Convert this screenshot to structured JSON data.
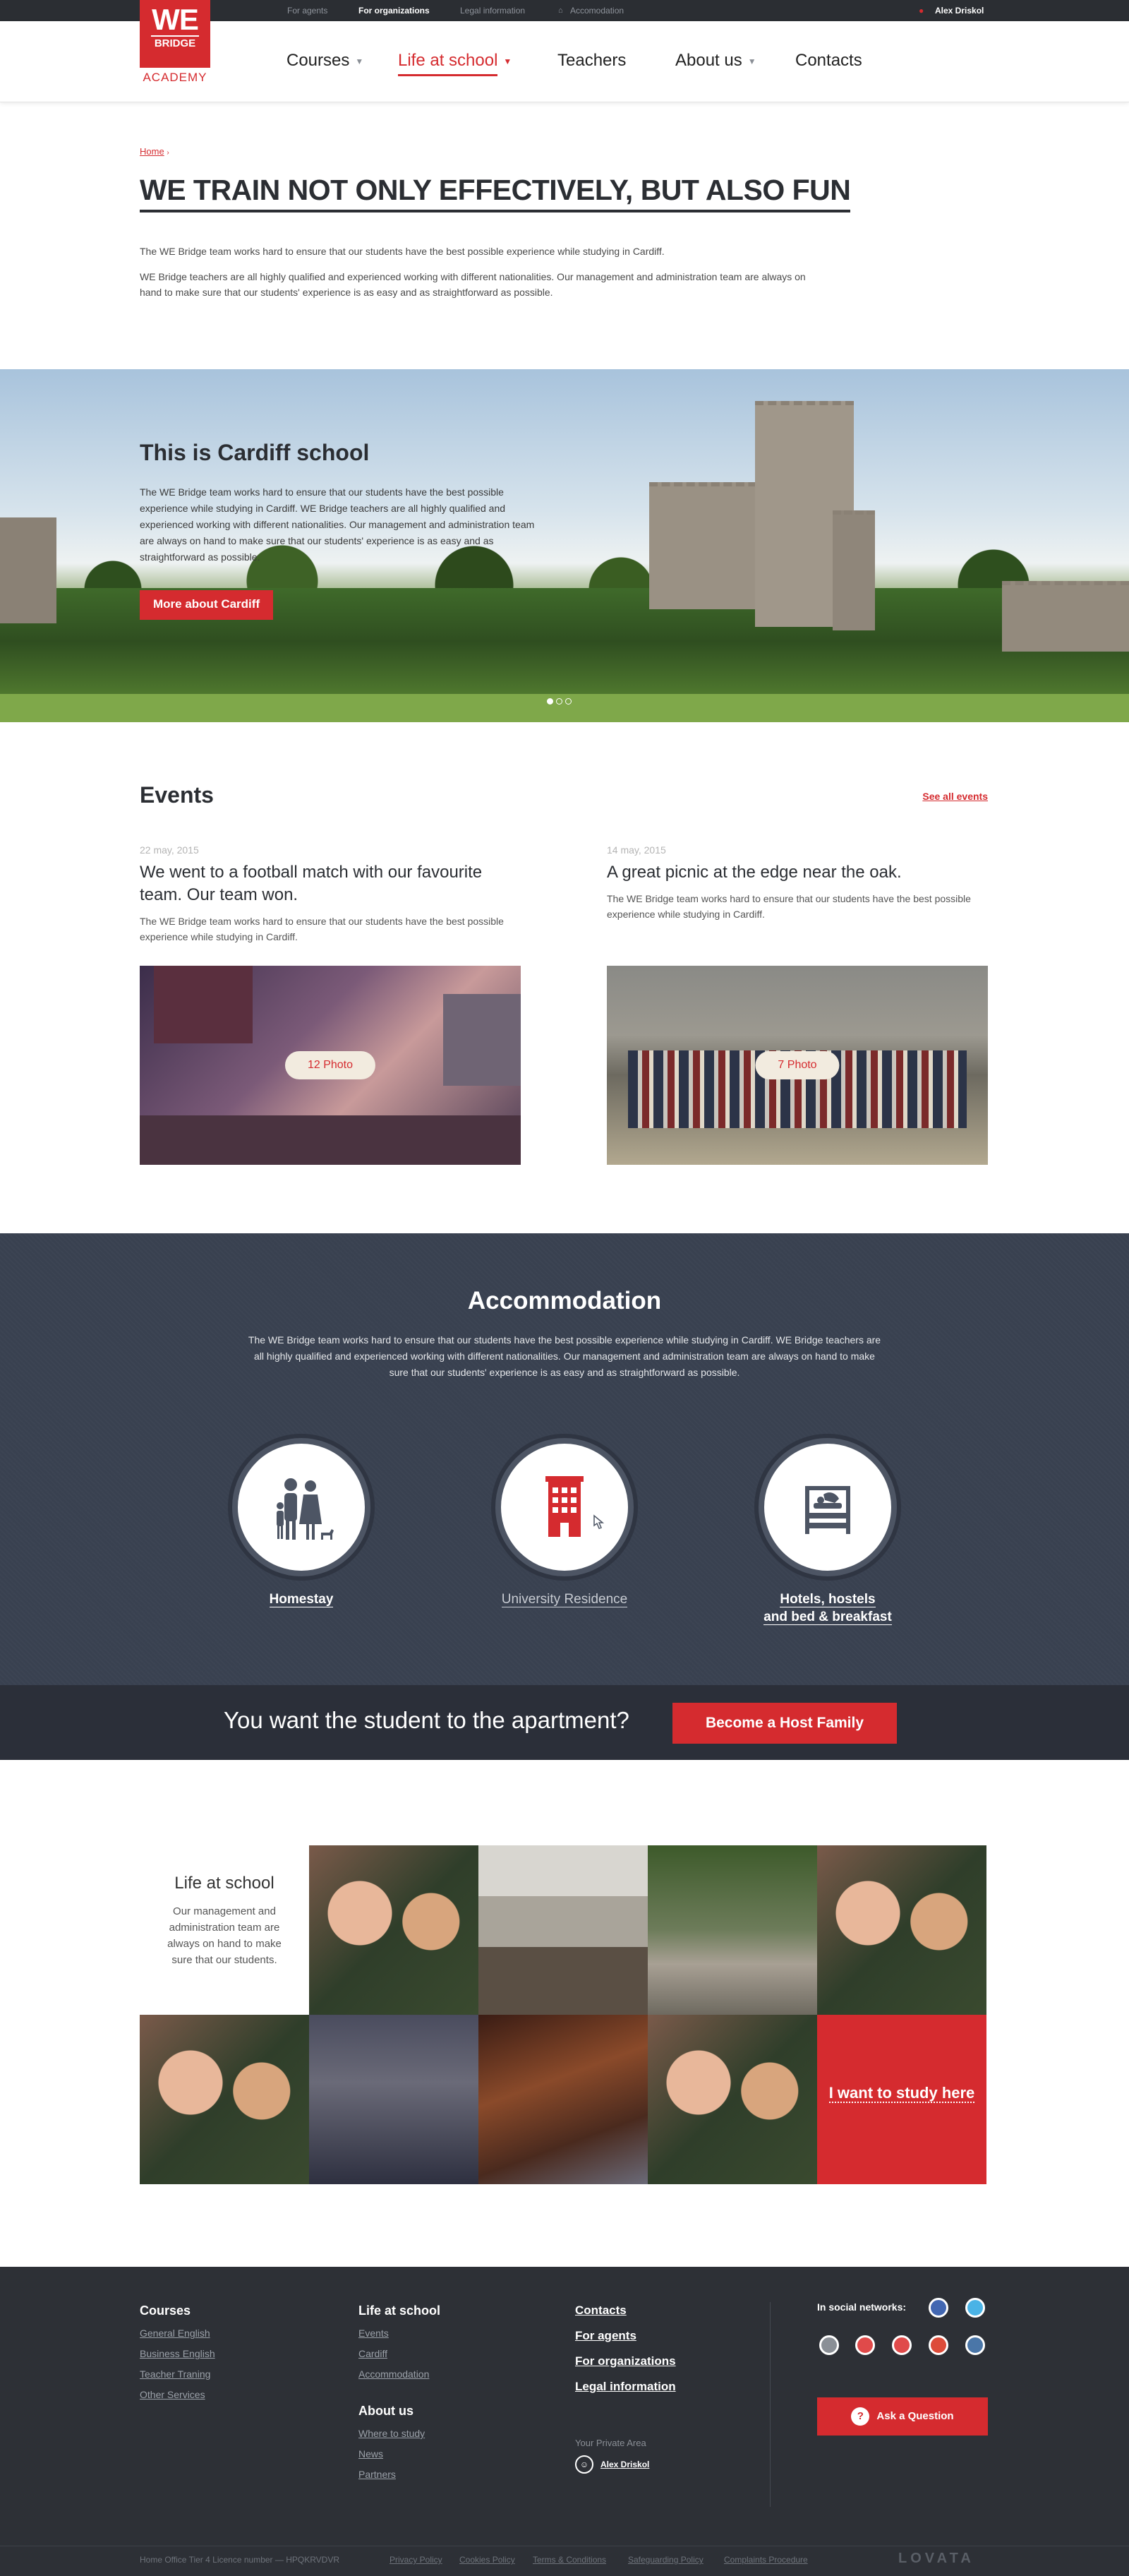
{
  "topbar": {
    "links": [
      "For agents",
      "For organizations",
      "Legal information",
      "Accomodation"
    ],
    "user": "Alex Driskol"
  },
  "logo": {
    "line1": "WE",
    "line2": "BRIDGE",
    "line3": "ACADEMY"
  },
  "nav": {
    "items": [
      "Courses",
      "Life at school",
      "Teachers",
      "About us",
      "Contacts"
    ]
  },
  "breadcrumb": "Home",
  "page": {
    "title": "WE TRAIN NOT ONLY EFFECTIVELY, BUT ALSO FUN",
    "p1": "The WE Bridge team works hard to ensure that our students have the best possible experience while studying in Cardiff.",
    "p2": "WE Bridge teachers are all highly qualified and experienced working with different nationalities. Our management and administration team are always on hand to make sure that our students' experience is as easy and as straightforward as possible."
  },
  "hero": {
    "title": "This is Cardiff school",
    "text": "The WE Bridge team works hard to ensure that our students have the best possible experience while studying in Cardiff. WE Bridge teachers are all highly qualified and experienced working with different nationalities. Our management and administration team are always on hand to make sure that our students' experience is as easy and as straightforward as possible.",
    "button": "More about Cardiff"
  },
  "events": {
    "title": "Events",
    "see_all": "See all events",
    "items": [
      {
        "date": "22 may, 2015",
        "title": "We went to a football match with our favourite team. Our team won.",
        "text": "The WE Bridge team works hard to ensure that our students have the best possible experience while studying in Cardiff.",
        "photos": "12 Photo"
      },
      {
        "date": "14 may, 2015",
        "title": "A great picnic at the edge near the oak.",
        "text": "The WE Bridge team works hard to ensure that our students have the best possible experience while studying in Cardiff.",
        "photos": "7 Photo"
      }
    ]
  },
  "accommodation": {
    "title": "Accommodation",
    "text": "The WE Bridge team works hard to ensure that our students have the best possible experience while studying in Cardiff. WE Bridge teachers are all highly qualified and experienced working with different nationalities. Our management and administration team are always on hand to make sure that our students' experience is as easy and as straightforward as possible.",
    "options": [
      {
        "label1": "Homestay",
        "label2": "",
        "icon": "family-icon"
      },
      {
        "label1": "University Residence",
        "label2": "",
        "icon": "building-icon"
      },
      {
        "label1": "Hotels, hostels",
        "label2": "and bed & breakfast",
        "icon": "bed-icon"
      }
    ]
  },
  "host": {
    "text": "You want the student to the apartment?",
    "button": "Become a Host Family"
  },
  "life": {
    "title": "Life at school",
    "text": "Our management and administration team are always on hand to make sure that our students.",
    "cta": "I want to study here"
  },
  "footer": {
    "courses": {
      "title": "Courses",
      "links": [
        "General English",
        "Business English",
        "Teacher Traning",
        "Other Services"
      ]
    },
    "life": {
      "title": "Life at school",
      "links": [
        "Events",
        "Cardiff",
        "Accommodation"
      ]
    },
    "about": {
      "title": "About us",
      "links": [
        "Where to study",
        "News",
        "Partners"
      ]
    },
    "main_links": [
      "Contacts",
      "For agents",
      "For organizations",
      "Legal information"
    ],
    "private_area": "Your Private Area",
    "user": "Alex Driskol",
    "social_label": "In social networks:",
    "ask": "Ask a Question",
    "licence": "Home Office Tier 4 Licence number — HPQKRVDVR",
    "legal": [
      "Privacy Policy",
      "Cookies Policy",
      "Terms & Conditions",
      "Safeguarding Policy",
      "Complaints Procedure"
    ],
    "brand": "LOVATA"
  },
  "colors": {
    "accent": "#d52b2f",
    "dark": "#2d3036",
    "slate": "#394150"
  }
}
